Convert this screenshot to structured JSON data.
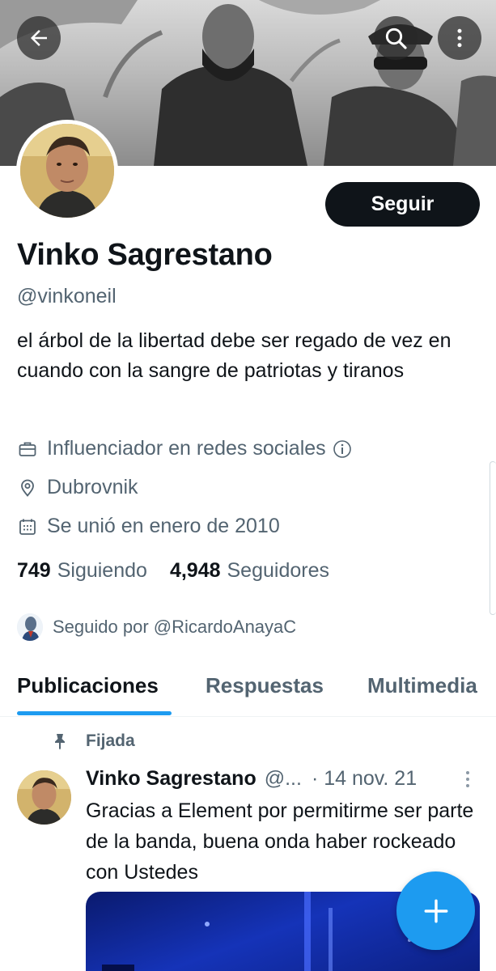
{
  "profile": {
    "display_name": "Vinko Sagrestano",
    "handle": "@vinkoneil",
    "bio": "el árbol de la libertad debe ser regado de vez en cuando con la sangre de patriotas y tiranos",
    "follow_label": "Seguir",
    "job": "Influenciador en redes sociales",
    "location": "Dubrovnik",
    "joined": "Se unió en enero de 2010",
    "following_count": "749",
    "following_label": "Siguiendo",
    "followers_count": "4,948",
    "followers_label": "Seguidores",
    "followed_by": "Seguido por @RicardoAnayaC"
  },
  "tabs": [
    {
      "label": "Publicaciones",
      "active": true
    },
    {
      "label": "Respuestas",
      "active": false
    },
    {
      "label": "Multimedia",
      "active": false
    }
  ],
  "pinned_post": {
    "pinned_label": "Fijada",
    "author": "Vinko Sagrestano",
    "handle": "@...",
    "date": "· 14 nov. 21",
    "text": "Gracias a Element por permitirme ser parte de la banda, buena onda haber rockeado con Ustedes"
  },
  "icons": {
    "back": "arrow-left-icon",
    "search": "search-icon",
    "more": "more-vertical-icon",
    "job": "briefcase-icon",
    "location": "map-pin-icon",
    "joined": "calendar-icon",
    "info": "info-icon",
    "pin": "pin-icon",
    "compose": "plus-icon"
  },
  "colors": {
    "accent": "#1d9bf0",
    "text_primary": "#0f1419",
    "text_secondary": "#536471",
    "follow_button": "#0f1419"
  }
}
